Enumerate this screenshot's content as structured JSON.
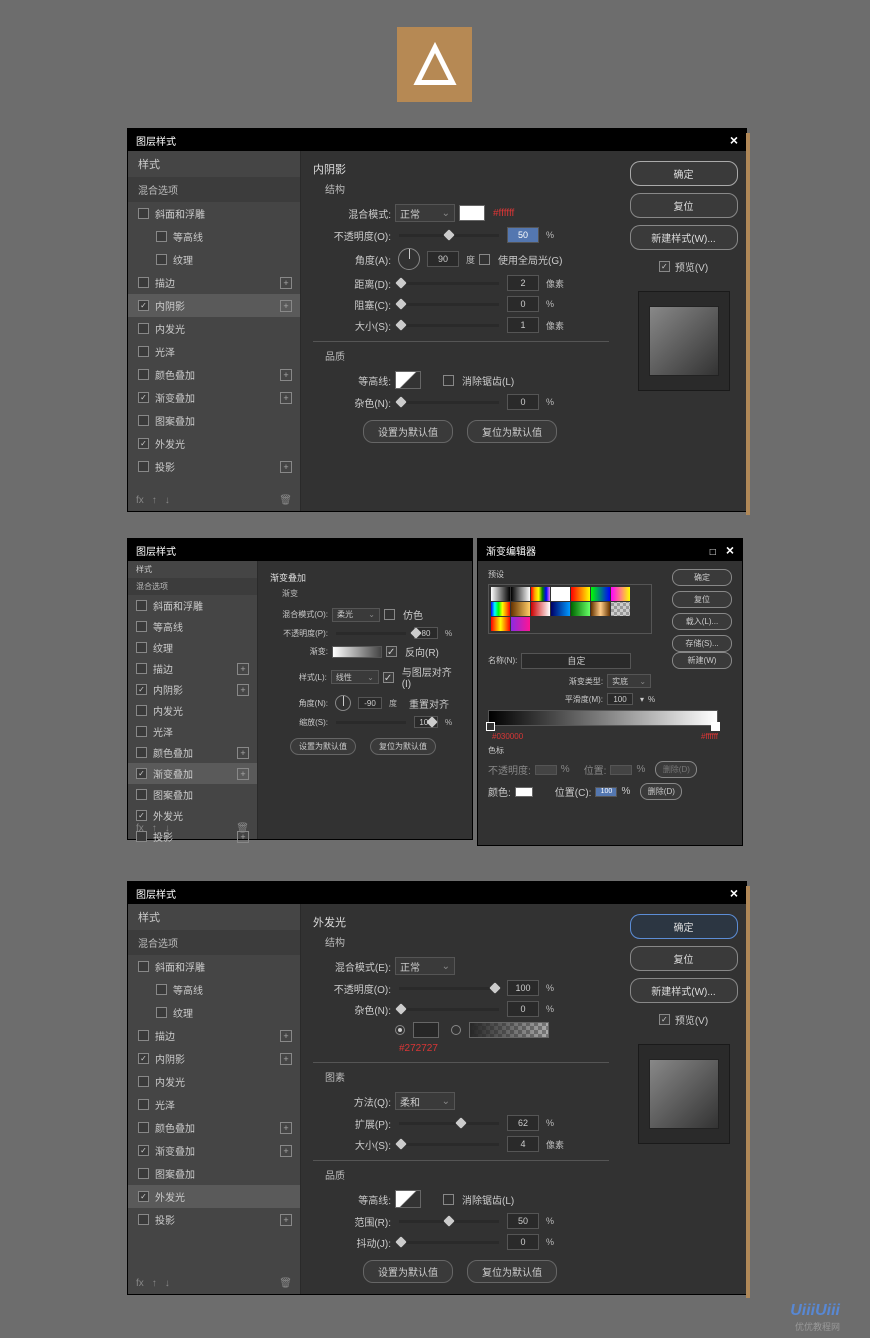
{
  "dialogTitle": "图层样式",
  "styleList": {
    "header": "样式",
    "blendOptions": "混合选项",
    "items": [
      {
        "label": "斜面和浮雕",
        "checked": false,
        "plus": false
      },
      {
        "label": "等高线",
        "checked": false,
        "indent": true
      },
      {
        "label": "纹理",
        "checked": false,
        "indent": true
      },
      {
        "label": "描边",
        "checked": false,
        "plus": true
      },
      {
        "label": "内阴影",
        "checked": true,
        "plus": true,
        "active1": true
      },
      {
        "label": "内发光",
        "checked": false
      },
      {
        "label": "光泽",
        "checked": false
      },
      {
        "label": "颜色叠加",
        "checked": false,
        "plus": true
      },
      {
        "label": "渐变叠加",
        "checked": true,
        "plus": true,
        "active2": true
      },
      {
        "label": "图案叠加",
        "checked": false
      },
      {
        "label": "外发光",
        "checked": true,
        "active3": true
      },
      {
        "label": "投影",
        "checked": false,
        "plus": true
      }
    ],
    "fxLabel": "fx"
  },
  "buttons": {
    "ok": "确定",
    "reset": "复位",
    "newStyle": "新建样式(W)...",
    "preview": "预览(V)",
    "setDefault": "设置为默认值",
    "resetDefault": "复位为默认值",
    "load": "载入(L)...",
    "save": "存储(S)...",
    "new": "新建(W)"
  },
  "innerShadow": {
    "title": "内阴影",
    "structTitle": "结构",
    "blendMode": {
      "label": "混合模式:",
      "value": "正常",
      "annotation": "#ffffff"
    },
    "opacity": {
      "label": "不透明度(O):",
      "value": "50",
      "unit": "%"
    },
    "angle": {
      "label": "角度(A):",
      "value": "90",
      "unit": "度",
      "globalLabel": "使用全局光(G)"
    },
    "distance": {
      "label": "距离(D):",
      "value": "2",
      "unit": "像素"
    },
    "choke": {
      "label": "阻塞(C):",
      "value": "0",
      "unit": "%"
    },
    "size": {
      "label": "大小(S):",
      "value": "1",
      "unit": "像素"
    },
    "qualityTitle": "品质",
    "contour": {
      "label": "等高线:",
      "antiLabel": "消除锯齿(L)"
    },
    "noise": {
      "label": "杂色(N):",
      "value": "0",
      "unit": "%"
    }
  },
  "gradOverlay": {
    "title": "渐变叠加",
    "structTitle": "渐变",
    "blendMode": {
      "label": "混合模式(O):",
      "value": "柔光",
      "ditherLabel": "仿色"
    },
    "opacity": {
      "label": "不透明度(P):",
      "value": "80",
      "unit": "%"
    },
    "gradient": {
      "label": "渐变:",
      "reverseLabel": "反向(R)"
    },
    "style": {
      "label": "样式(L):",
      "value": "线性",
      "alignLabel": "与图层对齐(I)"
    },
    "angle": {
      "label": "角度(N):",
      "value": "-90",
      "unit": "度",
      "resetAlign": "重置对齐"
    },
    "scale": {
      "label": "缩放(S):",
      "value": "100",
      "unit": "%"
    }
  },
  "outerGlow": {
    "title": "外发光",
    "structTitle": "结构",
    "blendMode": {
      "label": "混合模式(E):",
      "value": "正常"
    },
    "opacity": {
      "label": "不透明度(O):",
      "value": "100",
      "unit": "%"
    },
    "noise": {
      "label": "杂色(N):",
      "value": "0",
      "unit": "%"
    },
    "colorAnnotation": "#272727",
    "elementsTitle": "图素",
    "technique": {
      "label": "方法(Q):",
      "value": "柔和"
    },
    "spread": {
      "label": "扩展(P):",
      "value": "62",
      "unit": "%"
    },
    "size": {
      "label": "大小(S):",
      "value": "4",
      "unit": "像素"
    },
    "qualityTitle": "品质",
    "contour": {
      "label": "等高线:",
      "antiLabel": "消除锯齿(L)"
    },
    "range": {
      "label": "范围(R):",
      "value": "50",
      "unit": "%"
    },
    "jitter": {
      "label": "抖动(J):",
      "value": "0",
      "unit": "%"
    }
  },
  "gradEditor": {
    "title": "渐变编辑器",
    "presetsLabel": "预设",
    "name": {
      "label": "名称(N):",
      "value": "自定"
    },
    "type": {
      "label": "渐变类型:",
      "value": "实底"
    },
    "smooth": {
      "label": "平滑度(M):",
      "value": "100",
      "unit": "%"
    },
    "stopAnn1": "#030000",
    "stopAnn2": "#ffffff",
    "stopsTitle": "色标",
    "opacityStop": {
      "label": "不透明度:",
      "unit": "%",
      "loc": "位置:",
      "locUnit": "%",
      "del": "删除(D)"
    },
    "colorStop": {
      "label": "颜色:",
      "loc": "位置(C):",
      "locVal": "100",
      "locUnit": "%",
      "del": "删除(D)"
    }
  },
  "watermark": "UiiiUiii",
  "watermarkSub": "优优教程网"
}
